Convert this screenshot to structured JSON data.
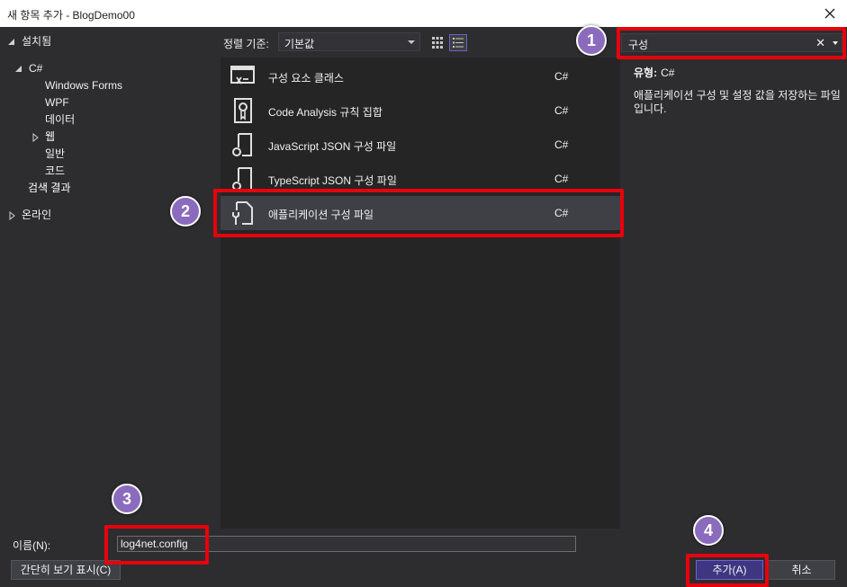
{
  "window": {
    "title": "새 항목 추가 - BlogDemo00"
  },
  "tree": [
    {
      "label": "설치됨",
      "arrow": "expanded"
    },
    {
      "label": "C#",
      "arrow": "expanded"
    },
    {
      "label": "Windows Forms",
      "arrow": ""
    },
    {
      "label": "WPF",
      "arrow": ""
    },
    {
      "label": "데이터",
      "arrow": ""
    },
    {
      "label": "웹",
      "arrow": "collapsed"
    },
    {
      "label": "일반",
      "arrow": ""
    },
    {
      "label": "코드",
      "arrow": ""
    },
    {
      "label": "검색 결과",
      "arrow": "",
      "selected": true
    },
    {
      "label": "온라인",
      "arrow": "collapsed"
    }
  ],
  "sort": {
    "label": "정렬 기준:",
    "value": "기본값"
  },
  "view_buttons": [
    {
      "icon": "grid-view-icon",
      "active": false
    },
    {
      "icon": "list-view-icon",
      "active": true
    }
  ],
  "templates": [
    {
      "name": "구성 요소 클래스",
      "lang": "C#",
      "icon": "component-class-icon"
    },
    {
      "name": "Code Analysis 규칙 집합",
      "lang": "C#",
      "icon": "ruleset-icon"
    },
    {
      "name": "JavaScript JSON 구성 파일",
      "lang": "C#",
      "icon": "json-config-icon"
    },
    {
      "name": "TypeScript JSON 구성 파일",
      "lang": "C#",
      "icon": "json-config-icon"
    },
    {
      "name": "애플리케이션 구성 파일",
      "lang": "C#",
      "icon": "app-config-icon",
      "selected": true
    }
  ],
  "search": {
    "value": "구성",
    "clear": "✕"
  },
  "details": {
    "type_label": "유형:",
    "type_value": "C#",
    "description": "애플리케이션 구성 및 설정 값을 저장하는 파일입니다."
  },
  "name_field": {
    "label": "이름(N):",
    "value": "log4net.config"
  },
  "buttons": {
    "compact": "간단히 보기 표시(C)",
    "add": "추가(A)",
    "cancel": "취소"
  },
  "annotations": [
    "1",
    "2",
    "3",
    "4"
  ],
  "colors": {
    "highlight": "#e8000c",
    "badge": "#8b6bbd",
    "accent_button": "#3e3680"
  }
}
